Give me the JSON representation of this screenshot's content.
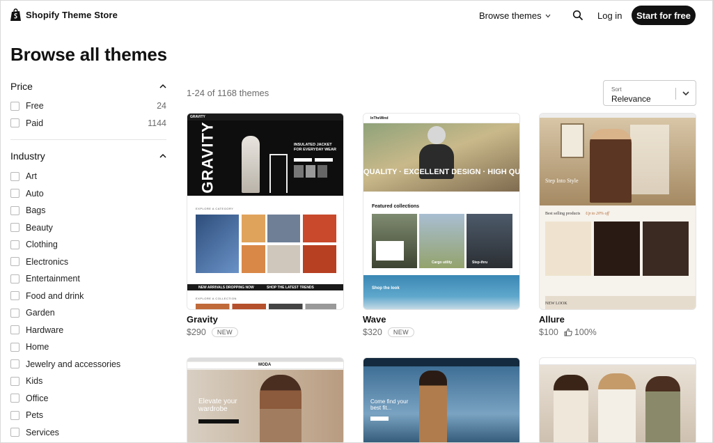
{
  "header": {
    "brand": "Shopify Theme Store",
    "browse_label": "Browse themes",
    "login_label": "Log in",
    "start_label": "Start for free"
  },
  "page_title": "Browse all themes",
  "filters": {
    "price": {
      "title": "Price",
      "options": [
        {
          "label": "Free",
          "count": "24"
        },
        {
          "label": "Paid",
          "count": "1144"
        }
      ]
    },
    "industry": {
      "title": "Industry",
      "options": [
        {
          "label": "Art"
        },
        {
          "label": "Auto"
        },
        {
          "label": "Bags"
        },
        {
          "label": "Beauty"
        },
        {
          "label": "Clothing"
        },
        {
          "label": "Electronics"
        },
        {
          "label": "Entertainment"
        },
        {
          "label": "Food and drink"
        },
        {
          "label": "Garden"
        },
        {
          "label": "Hardware"
        },
        {
          "label": "Home"
        },
        {
          "label": "Jewelry and accessories"
        },
        {
          "label": "Kids"
        },
        {
          "label": "Office"
        },
        {
          "label": "Pets"
        },
        {
          "label": "Services"
        }
      ]
    }
  },
  "results": {
    "count_text": "1-24 of 1168 themes",
    "sort_label": "Sort",
    "sort_value": "Relevance"
  },
  "themes": [
    {
      "name": "Gravity",
      "price": "$290",
      "badge": "NEW",
      "preview": {
        "logo": "GRAVITY",
        "hero_big": "GRAVITY",
        "hero_text": "INSULATED JACKET FOR EVERYDAY WEAR",
        "banner": "NEW ARRIVALS DROPPING NOW",
        "banner2": "SHOP THE LATEST TRENDS",
        "section": "EXPLORE A CATEGORY",
        "section2": "EXPLORE A COLLECTION"
      }
    },
    {
      "name": "Wave",
      "price": "$320",
      "badge": "NEW",
      "preview": {
        "logo": "InTheWind",
        "hero_text": "QUALITY · EXCELLENT DESIGN · HIGH QUA",
        "section": "Featured collections",
        "sub1": "Cargo utility",
        "sub2": "Step-thru",
        "footer": "Shop the look"
      }
    },
    {
      "name": "Allure",
      "price": "$100",
      "rating": "100%",
      "preview": {
        "hero_text": "Step Into Style",
        "section": "Best selling products",
        "section_accent": "Up to 20% off",
        "footer": "NEW LOOK"
      }
    },
    {
      "name": "",
      "price": "",
      "preview": {
        "logo": "MODA",
        "hero_text": "Elevate your wardrobe"
      }
    },
    {
      "name": "",
      "price": "",
      "preview": {
        "hero_text": "Come find your best fit..."
      }
    },
    {
      "name": "",
      "price": "",
      "preview": {}
    }
  ],
  "colors": {
    "primary": "#111111",
    "muted": "#6b6b6b",
    "border": "#d9d9d9",
    "gravity_red": "#c8492b",
    "wave_blue": "#3a87b4"
  }
}
